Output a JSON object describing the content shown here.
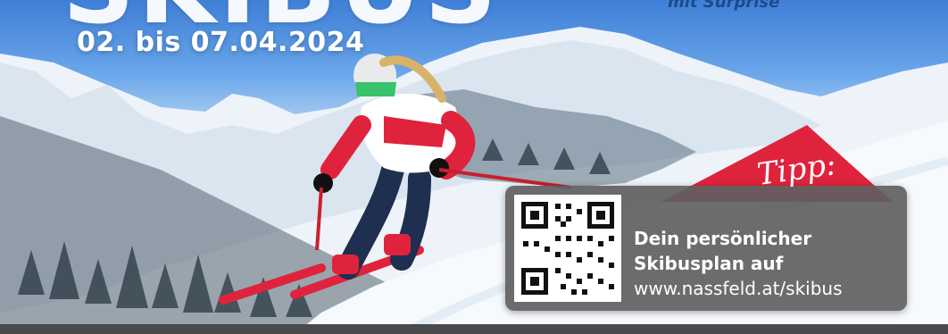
{
  "header": {
    "big_title": "SKIBUS",
    "dates": "02. bis 07.04.2024",
    "tagline": "mit Surprise"
  },
  "tip": {
    "label": "Tipp:",
    "line1": "Dein persönlicher",
    "line2": "Skibusplan auf",
    "url": "www.nassfeld.at/skibus"
  },
  "colors": {
    "accent_red": "#e0233c",
    "panel_gray": "#5f5f61",
    "sky_blue": "#3f7fd6",
    "text_white": "#ffffff"
  },
  "icons": [
    "qr-code-icon"
  ]
}
